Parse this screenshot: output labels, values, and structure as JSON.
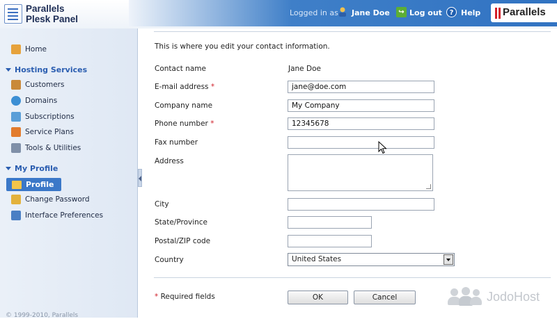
{
  "header": {
    "app_name_line1": "Parallels",
    "app_name_line2": "Plesk Panel",
    "logged_in_label": "Logged in as",
    "user_name": "Jane Doe",
    "logout_label": "Log out",
    "help_label": "Help",
    "brand": "Parallels"
  },
  "sidebar": {
    "home": "Home",
    "hosting_section": "Hosting Services",
    "hosting_items": [
      "Customers",
      "Domains",
      "Subscriptions",
      "Service Plans",
      "Tools & Utilities"
    ],
    "profile_section": "My Profile",
    "profile_active": "Profile",
    "profile_items": [
      "Change Password",
      "Interface Preferences"
    ],
    "copyright": "© 1999-2010, Parallels"
  },
  "form": {
    "intro": "This is where you edit your contact information.",
    "contact_name_label": "Contact name",
    "contact_name_value": "Jane Doe",
    "email_label": "E-mail address",
    "email_value": "jane@doe.com",
    "company_label": "Company name",
    "company_value": "My Company",
    "phone_label": "Phone number",
    "phone_value": "12345678",
    "fax_label": "Fax number",
    "fax_value": "",
    "address_label": "Address",
    "city_label": "City",
    "state_label": "State/Province",
    "zip_label": "Postal/ZIP code",
    "country_label": "Country",
    "country_value": "United States",
    "required_marker": "*",
    "required_note": "Required fields",
    "ok_label": "OK",
    "cancel_label": "Cancel"
  },
  "watermark": "JodoHost",
  "colors": {
    "accent": "#3b78c8",
    "required": "#d0202a",
    "brand_red": "#d3202a"
  }
}
